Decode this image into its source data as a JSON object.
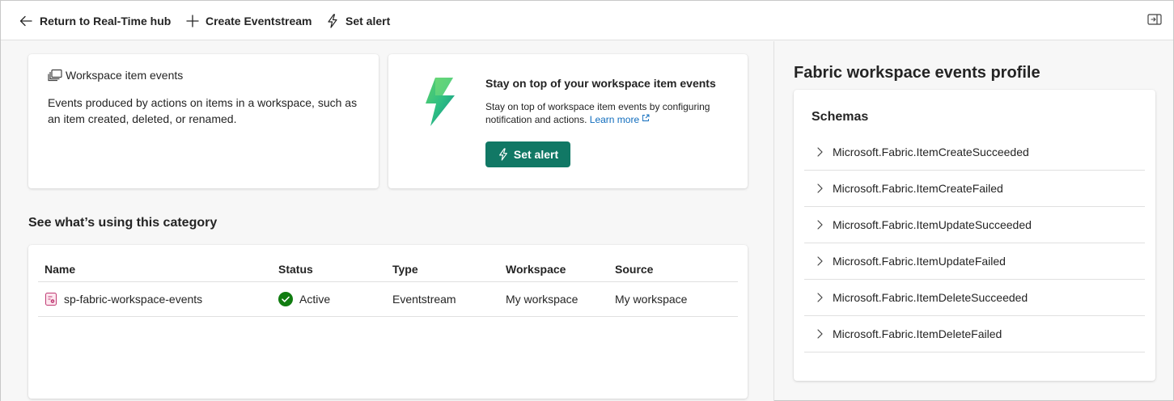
{
  "toolbar": {
    "return_label": "Return to Real-Time hub",
    "create_label": "Create Eventstream",
    "alert_label": "Set alert"
  },
  "info_card": {
    "title": "Workspace item events",
    "description": "Events produced by actions on items in a workspace, such as an item created, deleted, or renamed."
  },
  "alert_card": {
    "heading": "Stay on top of your workspace item events",
    "text": "Stay on top of workspace item events by configuring notification and actions.",
    "learn_more": "Learn more",
    "button_label": "Set alert"
  },
  "usage": {
    "title": "See what’s using this category",
    "columns": [
      "Name",
      "Status",
      "Type",
      "Workspace",
      "Source"
    ],
    "rows": [
      {
        "name": "sp-fabric-workspace-events",
        "status": "Active",
        "type": "Eventstream",
        "workspace": "My workspace",
        "source": "My workspace"
      }
    ]
  },
  "profile": {
    "title": "Fabric workspace events profile",
    "schemas_label": "Schemas",
    "schemas": [
      "Microsoft.Fabric.ItemCreateSucceeded",
      "Microsoft.Fabric.ItemCreateFailed",
      "Microsoft.Fabric.ItemUpdateSucceeded",
      "Microsoft.Fabric.ItemUpdateFailed",
      "Microsoft.Fabric.ItemDeleteSucceeded",
      "Microsoft.Fabric.ItemDeleteFailed"
    ]
  },
  "colors": {
    "accent": "#117865",
    "link": "#0f6cbd",
    "status_active": "#107c10"
  },
  "icons": {
    "return": "arrow-left-icon",
    "create": "plus-icon",
    "alert": "flash-icon",
    "panel": "panel-collapse-icon",
    "info": "workspace-items-icon",
    "status": "check-circle-icon",
    "expand": "chevron-right-icon"
  }
}
